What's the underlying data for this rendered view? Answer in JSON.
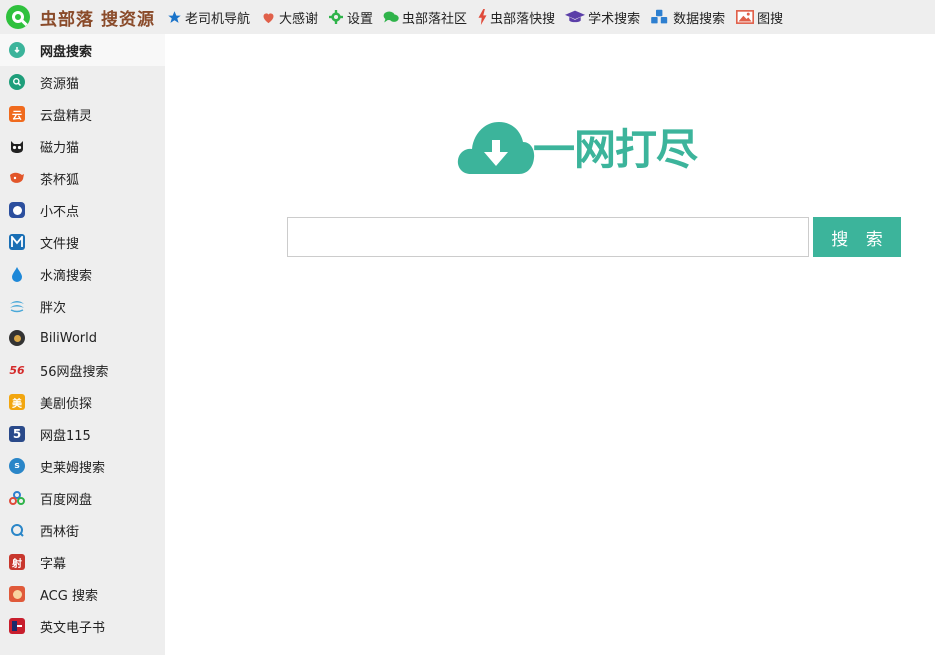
{
  "brand": {
    "name_part1": "虫部落",
    "name_part2": "搜资源"
  },
  "topnav": [
    {
      "label": "老司机导航",
      "icon": "star-icon",
      "color": "#1a73c9"
    },
    {
      "label": "大感谢",
      "icon": "heart-icon",
      "color": "#e0604a"
    },
    {
      "label": "设置",
      "icon": "gear-icon",
      "color": "#2fb34a"
    },
    {
      "label": "虫部落社区",
      "icon": "chat-icon",
      "color": "#2fb34a"
    },
    {
      "label": "虫部落快搜",
      "icon": "bolt-icon",
      "color": "#e04a3a"
    },
    {
      "label": "学术搜索",
      "icon": "graduation-cap-icon",
      "color": "#5b3fa8"
    },
    {
      "label": "数据搜索",
      "icon": "cubes-icon",
      "color": "#2d7fd0"
    },
    {
      "label": "图搜",
      "icon": "image-icon",
      "color": "#e0604a"
    }
  ],
  "sidebar": {
    "items": [
      {
        "label": "网盘搜索",
        "active": true
      },
      {
        "label": "资源猫"
      },
      {
        "label": "云盘精灵"
      },
      {
        "label": "磁力猫"
      },
      {
        "label": "茶杯狐"
      },
      {
        "label": "小不点"
      },
      {
        "label": "文件搜"
      },
      {
        "label": "水滴搜索"
      },
      {
        "label": "胖次"
      },
      {
        "label": "BiliWorld"
      },
      {
        "label": "56网盘搜索"
      },
      {
        "label": "美剧侦探"
      },
      {
        "label": "网盘115"
      },
      {
        "label": "史莱姆搜索"
      },
      {
        "label": "百度网盘"
      },
      {
        "label": "西林街"
      },
      {
        "label": "字幕"
      },
      {
        "label": "ACG 搜索"
      },
      {
        "label": "英文电子书"
      }
    ]
  },
  "main": {
    "logo_text": "一网打尽",
    "search": {
      "value": "",
      "placeholder": ""
    },
    "search_button": "搜 索"
  },
  "colors": {
    "accent": "#3cb49b",
    "brand": "#8a4b2a"
  }
}
